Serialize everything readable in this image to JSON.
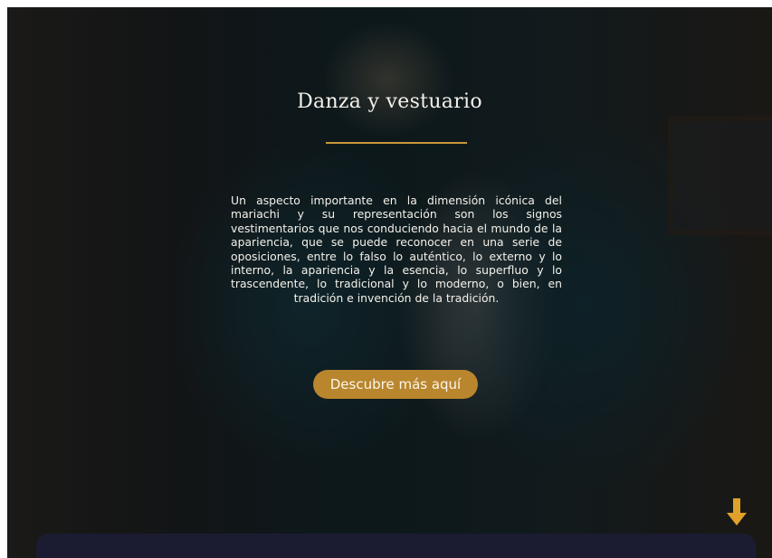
{
  "section": {
    "title": "Danza y vestuario",
    "body": "Un aspecto importante en la dimensión icónica del mariachi y su representación son los signos vestimentarios que nos conduciendo hacia el mundo de la apariencia, que se puede reconocer en una serie de oposiciones, entre lo falso lo auténtico, lo externo y lo interno, la apariencia y la esencia, lo superfluo y lo trascendente, lo tradicional y lo moderno, o bien, en tradición e invención de la tradición.",
    "cta_label": "Descubre más aquí"
  },
  "icons": {
    "scroll": "arrow-down-icon"
  },
  "colors": {
    "accent": "#c9973a",
    "button": "#b9862e",
    "bottom_bar": "#1b1c31",
    "text": "#f4f1ea"
  }
}
